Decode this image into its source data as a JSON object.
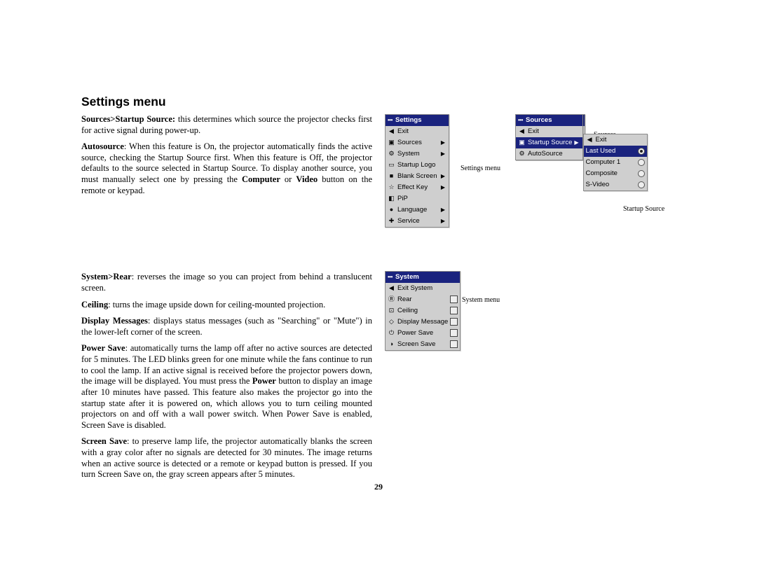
{
  "heading": "Settings menu",
  "paragraphs": {
    "p1a": "Sources>Startup Source:",
    "p1b": " this determines which source the projector checks first for active signal during power-up.",
    "p2a": "Autosource",
    "p2b": ": When this feature is On, the projector automatically finds the active source, checking the Startup Source first. When this feature is Off, the projector defaults to the source selected in Startup Source. To display another source, you must manually select one by pressing the ",
    "p2c": "Computer",
    "p2d": " or ",
    "p2e": "Video",
    "p2f": " button on the remote or keypad.",
    "p3a": "System>Rear",
    "p3b": ": reverses the image so you can project from behind a translucent screen.",
    "p4a": "Ceiling",
    "p4b": ": turns the image upside down for ceiling-mounted projection.",
    "p5a": "Display Messages",
    "p5b": ": displays status messages (such as \"Searching\" or \"Mute\") in the lower-left corner of the screen.",
    "p6a": "Power Save",
    "p6b": ": automatically turns the lamp off after no active sources are detected for 5 minutes. The LED blinks green for one minute while the fans continue to run to cool the lamp. If an active signal is received before the projector powers down, the image will be displayed. You must press the ",
    "p6c": "Power",
    "p6d": " button to display an image after 10 minutes have passed. This feature also makes the projector go into the startup state after it is powered on, which allows you to turn ceiling mounted projectors on and off with a wall power switch. When Power Save is enabled, Screen Save is disabled.",
    "p7a": "Screen Save",
    "p7b": ": to preserve lamp life, the projector automatically blanks the screen with a gray color after no signals are detected for 30 minutes. The image returns when an active source is detected or a remote or keypad button is pressed. If you turn Screen Save on, the gray screen appears after 5 minutes."
  },
  "captions": {
    "settings": "Settings menu",
    "sources": "Sources",
    "startup_source": "Startup Source",
    "system": "System menu"
  },
  "menus": {
    "settings": {
      "title": "Settings",
      "items": [
        {
          "icon": "◀",
          "label": "Exit"
        },
        {
          "icon": "▣",
          "label": "Sources",
          "arrow": true
        },
        {
          "icon": "⚙",
          "label": "System",
          "arrow": true
        },
        {
          "icon": "▭",
          "label": "Startup Logo"
        },
        {
          "icon": "■",
          "label": "Blank Screen",
          "arrow": true
        },
        {
          "icon": "☆",
          "label": "Effect Key",
          "arrow": true
        },
        {
          "icon": "◧",
          "label": "PiP"
        },
        {
          "icon": "●",
          "label": "Language",
          "arrow": true
        },
        {
          "icon": "✚",
          "label": "Service",
          "arrow": true
        }
      ]
    },
    "sources_top": {
      "title": "Sources",
      "items": [
        {
          "icon": "◀",
          "label": "Exit"
        },
        {
          "icon": "▣",
          "label": "Start-up Source",
          "arrow": true
        },
        {
          "icon": "⚙",
          "label": "Autosource"
        }
      ]
    },
    "sources_expanded": {
      "title": "Sources",
      "items": [
        {
          "icon": "◀",
          "label": "Exit"
        },
        {
          "icon": "▣",
          "label": "Startup Source",
          "arrow": true,
          "selected": true
        },
        {
          "icon": "⚙",
          "label": "AutoSource"
        }
      ],
      "submenu": [
        {
          "label": "Exit",
          "icon": "◀"
        },
        {
          "label": "Last Used",
          "selected": true,
          "radio": true,
          "on": true
        },
        {
          "label": "Computer 1",
          "radio": true
        },
        {
          "label": "Composite",
          "radio": true
        },
        {
          "label": "S-Video",
          "radio": true
        }
      ]
    },
    "system": {
      "title": "System",
      "items": [
        {
          "icon": "◀",
          "label": "Exit System"
        },
        {
          "icon": "Ⓡ",
          "label": "Rear",
          "checkbox": true
        },
        {
          "icon": "⊡",
          "label": "Ceiling",
          "checkbox": true
        },
        {
          "icon": "◇",
          "label": "Display Message",
          "checkbox": true
        },
        {
          "icon": "⏻",
          "label": "Power Save",
          "checkbox": true
        },
        {
          "icon": "◑",
          "label": "Screen Save",
          "checkbox": true
        }
      ]
    }
  },
  "page_number": "29"
}
